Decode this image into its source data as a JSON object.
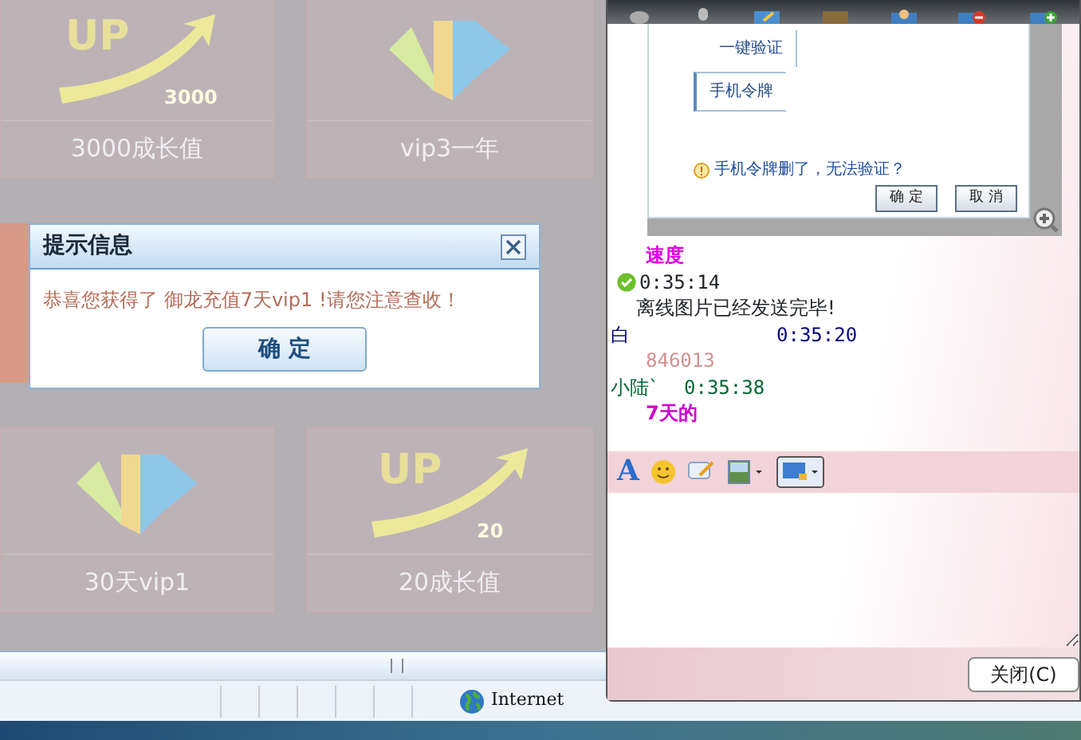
{
  "tiles": [
    {
      "label": "3000成长值",
      "kind": "up",
      "title": "UP",
      "badge": "3000"
    },
    {
      "label": "vip3一年",
      "kind": "vip"
    },
    {
      "label": "30天vip1",
      "kind": "vip"
    },
    {
      "label": "20成长值",
      "kind": "up",
      "title": "UP",
      "badge": "20"
    }
  ],
  "dialog": {
    "title": "提示信息",
    "message": "恭喜您获得了 御龙充值7天vip1 !请您注意查收！",
    "button": "确 定"
  },
  "chat": {
    "screenshot": {
      "tabs": [
        {
          "label": "一键验证",
          "selected": false
        },
        {
          "label": "手机令牌",
          "selected": true
        }
      ],
      "warning": "手机令牌删了，无法验证？",
      "buttons": [
        "确 定",
        "取 消"
      ]
    },
    "messages": [
      {
        "kind": "body",
        "text": "速度",
        "color": "#e000e0",
        "bold": true
      },
      {
        "kind": "system",
        "time": "0:35:14",
        "text": "离线图片已经发送完毕!"
      },
      {
        "kind": "header",
        "sender": "白",
        "time": "0:35:20",
        "color": "#000080"
      },
      {
        "kind": "body",
        "text": "846013",
        "color": "#d09090",
        "bold": false
      },
      {
        "kind": "header",
        "sender": "小陆`",
        "time": "0:35:38",
        "color": "#006633"
      },
      {
        "kind": "body",
        "text": "7天的",
        "color": "#cc00cc",
        "bold": true
      }
    ],
    "font_button": "A",
    "close_button": "关闭(C)"
  },
  "status_bar": {
    "zone": "Internet"
  }
}
